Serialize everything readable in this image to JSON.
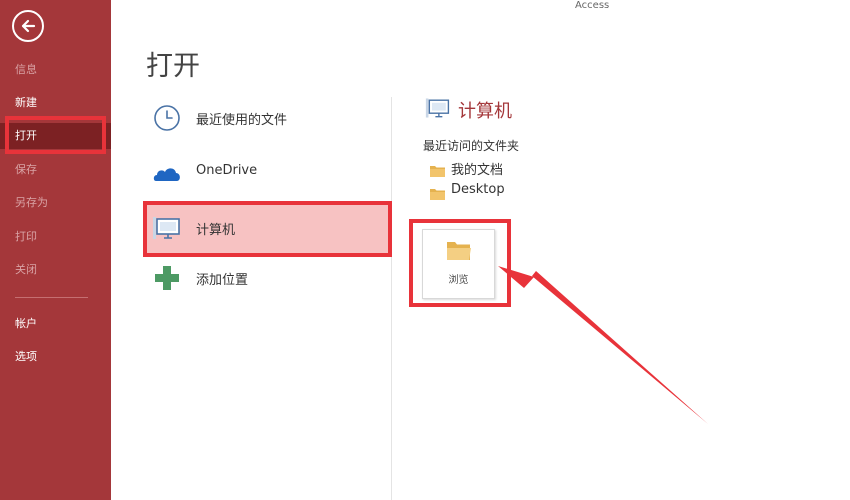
{
  "app": {
    "title": "Access"
  },
  "page": {
    "heading": "打开"
  },
  "sidebar": {
    "items": [
      {
        "label": "信息",
        "enabled": false
      },
      {
        "label": "新建",
        "enabled": true
      },
      {
        "label": "打开",
        "enabled": true,
        "selected": true
      },
      {
        "label": "保存",
        "enabled": false
      },
      {
        "label": "另存为",
        "enabled": false
      },
      {
        "label": "打印",
        "enabled": false
      },
      {
        "label": "关闭",
        "enabled": false
      },
      {
        "label": "帐户",
        "enabled": true
      },
      {
        "label": "选项",
        "enabled": true
      }
    ]
  },
  "locations": [
    {
      "label": "最近使用的文件",
      "icon": "clock-icon"
    },
    {
      "label": "OneDrive",
      "icon": "onedrive-cloud-icon"
    },
    {
      "label": "计算机",
      "icon": "computer-icon",
      "selected": true
    },
    {
      "label": "添加位置",
      "icon": "plus-icon"
    }
  ],
  "computer_pane": {
    "title": "计算机",
    "recent_folders_label": "最近访问的文件夹",
    "folders": [
      {
        "label": "我的文档",
        "icon": "folder-icon"
      },
      {
        "label": "Desktop",
        "icon": "folder-icon"
      }
    ],
    "browse_label": "浏览"
  },
  "colors": {
    "sidebar_bg": "#a4373a",
    "sidebar_selected_bg": "#7c2123",
    "accent": "#a4373a",
    "annotation_red": "#e8333a",
    "selected_location_bg": "#f7c2c2",
    "folder_yellow": "#f2c46b"
  }
}
